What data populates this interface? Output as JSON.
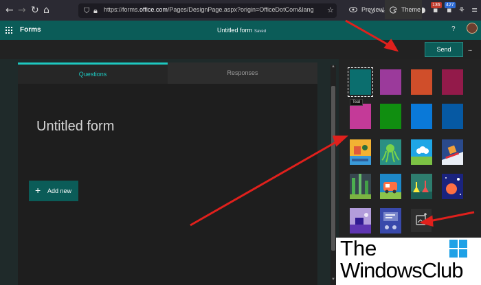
{
  "browser": {
    "url_prefix": "https://forms.",
    "url_domain": "office.com",
    "url_rest": "/Pages/DesignPage.aspx?origin=OfficeDotCom&lang=en-US&route=Start&fro",
    "badge1": "136",
    "badge2": "427"
  },
  "app": {
    "name": "Forms",
    "form_title": "Untitled form",
    "saved_label": "Saved",
    "help": "?"
  },
  "commands": {
    "preview": "Preview",
    "theme": "Theme",
    "send": "Send",
    "more": "..."
  },
  "tabs": {
    "questions": "Questions",
    "responses": "Responses"
  },
  "form": {
    "title": "Untitled form",
    "add_new": "Add new"
  },
  "themes": {
    "tooltip": "Teal",
    "solid_colors": [
      "#0b6e6e",
      "#9b3a9b",
      "#d04e2a",
      "#931a4a",
      "#c43a98",
      "#108e10",
      "#0a79d8",
      "#0659a3"
    ]
  },
  "watermark": {
    "line1": "The",
    "line2": "WindowsClub"
  },
  "colors": {
    "accent": "#0b5c58",
    "tab_active": "#1ec8c0",
    "annotation_arrow": "#e0201c"
  }
}
